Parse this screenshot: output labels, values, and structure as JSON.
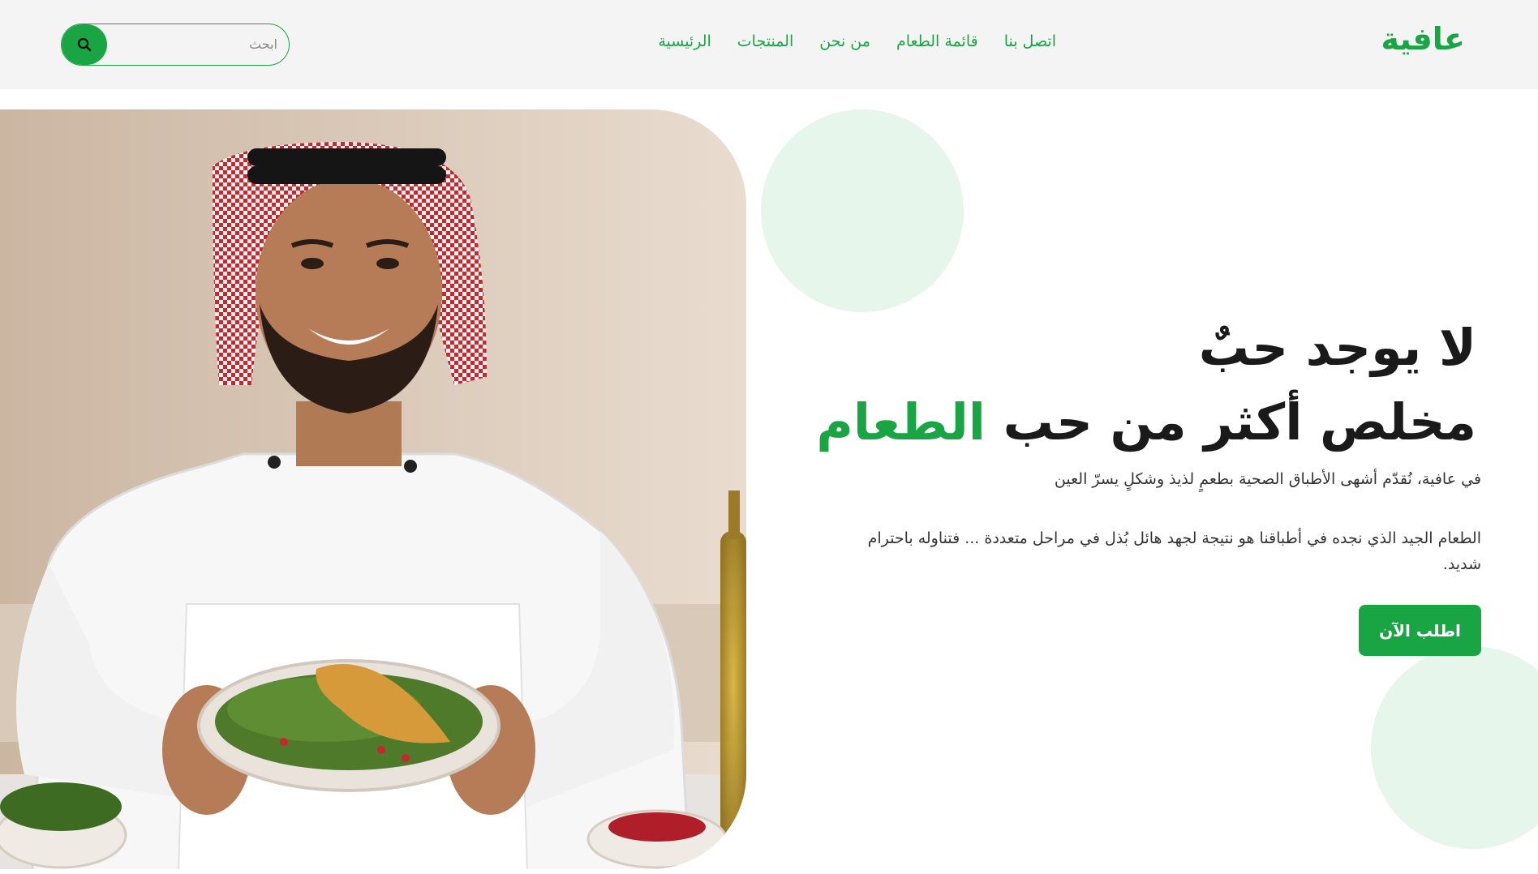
{
  "brand": {
    "name": "عافية"
  },
  "nav": {
    "items": [
      {
        "label": "الرئيسية"
      },
      {
        "label": "المنتجات"
      },
      {
        "label": "من نحن"
      },
      {
        "label": "قائمة الطعام"
      },
      {
        "label": "اتصل بنا"
      }
    ]
  },
  "search": {
    "placeholder": "ابحث",
    "icon": "search-icon"
  },
  "hero": {
    "headline_line1": "لا يوجد حبٌ",
    "headline_line2_a": "مخلص أكثر من حب",
    "headline_line2_b": "الطعام",
    "lead": "في عافية، نُقدّم أشهى الأطباق الصحية بطعمٍ لذيذ وشكلٍ يسرّ العين",
    "body": "الطعام الجيد الذي نجده في أطباقنا هو نتيجة لجهد هائل بُذل في مراحل متعددة ... فتناوله باحترام شديد.",
    "cta_label": "اطلب الآن"
  },
  "colors": {
    "accent": "#1aa544",
    "accent_light": "#e6f6ea",
    "topbar_bg": "#f4f4f4"
  }
}
